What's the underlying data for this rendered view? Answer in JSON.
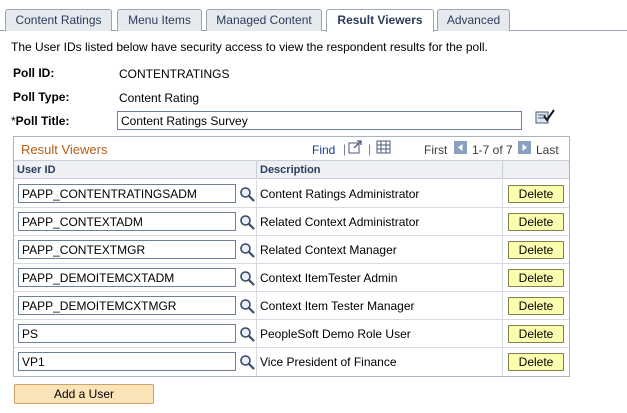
{
  "tabs": [
    {
      "label": "Content Ratings"
    },
    {
      "label": "Menu Items"
    },
    {
      "label": "Managed Content"
    },
    {
      "label": "Result Viewers"
    },
    {
      "label": "Advanced"
    }
  ],
  "active_tab": "Result Viewers",
  "intro_text": "The User IDs listed below have security access to view the respondent results for the poll.",
  "fields": {
    "poll_id_label": "Poll ID:",
    "poll_id_value": "CONTENTRATINGS",
    "poll_type_label": "Poll Type:",
    "poll_type_value": "Content Rating",
    "poll_title_required": "*",
    "poll_title_label": "Poll Title:",
    "poll_title_value": "Content Ratings Survey"
  },
  "grid": {
    "title": "Result Viewers",
    "find_label": "Find",
    "sep": "|",
    "first_label": "First",
    "range_label": "1-7 of 7",
    "last_label": "Last",
    "columns": {
      "user_id": "User ID",
      "description": "Description"
    },
    "rows": [
      {
        "user_id": "PAPP_CONTENTRATINGSADM",
        "description": "Content Ratings Administrator",
        "delete": "Delete"
      },
      {
        "user_id": "PAPP_CONTEXTADM",
        "description": "Related Context Administrator",
        "delete": "Delete"
      },
      {
        "user_id": "PAPP_CONTEXTMGR",
        "description": "Related Context Manager",
        "delete": "Delete"
      },
      {
        "user_id": "PAPP_DEMOITEMCXTADM",
        "description": "Context ItemTester Admin",
        "delete": "Delete"
      },
      {
        "user_id": "PAPP_DEMOITEMCXTMGR",
        "description": "Context Item Tester Manager",
        "delete": "Delete"
      },
      {
        "user_id": "PS",
        "description": "PeopleSoft Demo Role User",
        "delete": "Delete"
      },
      {
        "user_id": "VP1",
        "description": "Vice President of Finance",
        "delete": "Delete"
      }
    ]
  },
  "add_button_label": "Add a User",
  "colors": {
    "grid_title": "#b85c14",
    "delete_button": "#fdfdb0",
    "add_button": "#fbe3b8",
    "link": "#1a3a8a"
  }
}
